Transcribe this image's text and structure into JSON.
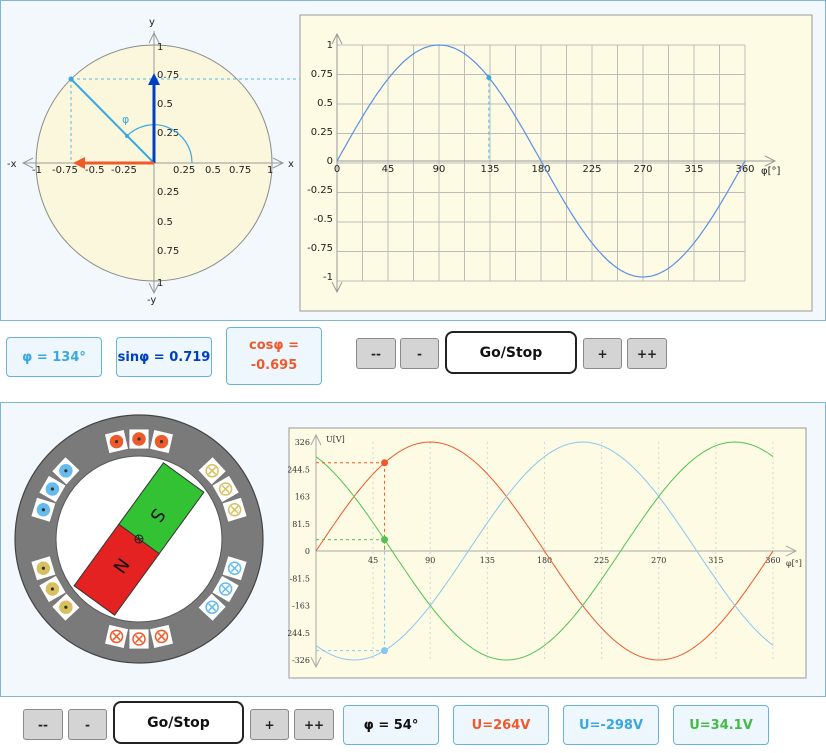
{
  "top": {
    "circle": {
      "axis_x": "x",
      "axis_neg_x": "-x",
      "axis_y": "y",
      "axis_neg_y": "-y",
      "angle_label": "φ",
      "x_ticks": [
        "-1",
        "-0.75",
        "-0.5",
        "-0.25",
        "0.25",
        "0.5",
        "0.75",
        "1"
      ],
      "y_ticks_pos": [
        "1",
        "0.75",
        "0.5",
        "0.25"
      ],
      "y_ticks_neg": [
        "0.25",
        "0.5",
        "0.75",
        "1"
      ]
    },
    "sine_chart": {
      "x_ticks": [
        "0",
        "45",
        "90",
        "135",
        "180",
        "225",
        "270",
        "315",
        "360"
      ],
      "y_ticks": [
        "1",
        "0.75",
        "0.5",
        "0.25",
        "0",
        "-0.25",
        "-0.5",
        "-0.75",
        "-1"
      ],
      "x_unit": "φ[°]"
    },
    "readouts": {
      "phi": "φ = 134°",
      "sin": "sinφ = 0.719",
      "cos": "cosφ = -0.695"
    },
    "controls": {
      "fast_back": "--",
      "back": "-",
      "go_stop": "Go/Stop",
      "forward": "+",
      "fast_forward": "++"
    }
  },
  "bottom": {
    "generator": {
      "north_label": "N",
      "south_label": "S"
    },
    "voltage_chart": {
      "y_unit": "U[V]",
      "x_unit": "φ[°]",
      "y_ticks": [
        "326",
        "244.5",
        "163",
        "81.5",
        "0",
        "-81.5",
        "-163",
        "-244.5",
        "-326"
      ],
      "x_ticks": [
        "45",
        "90",
        "135",
        "180",
        "225",
        "270",
        "315",
        "360"
      ]
    },
    "controls": {
      "fast_back": "--",
      "back": "-",
      "go_stop": "Go/Stop",
      "forward": "+",
      "fast_forward": "++"
    },
    "readouts": {
      "phi": "φ = 54°",
      "u1": "U=264V",
      "u2": "U=-298V",
      "u3": "U=34.1V"
    }
  },
  "chart_data": [
    {
      "type": "line",
      "title": "",
      "xlabel": "φ[°]",
      "ylabel": "",
      "xlim": [
        0,
        360
      ],
      "ylim": [
        -1,
        1
      ],
      "series": [
        {
          "function": "sin(φ)"
        }
      ],
      "marker": {
        "x": 134,
        "y": 0.719
      }
    },
    {
      "type": "line",
      "title": "",
      "xlabel": "φ[°]",
      "ylabel": "U[V]",
      "xlim": [
        0,
        360
      ],
      "ylim": [
        -326,
        326
      ],
      "series": [
        {
          "function": "326·sin(φ)",
          "color": "#ee5a2a"
        },
        {
          "function": "326·sin(φ-120°)",
          "color": "#88c8f0"
        },
        {
          "function": "326·sin(φ+120°)",
          "color": "#52c152"
        }
      ],
      "markers": [
        {
          "x": 54,
          "y": 264,
          "color": "#ee5a2a"
        },
        {
          "x": 54,
          "y": -298,
          "color": "#88c8f0"
        },
        {
          "x": 54,
          "y": 34.1,
          "color": "#52c152"
        }
      ]
    }
  ],
  "colors": {
    "orange": "#ee5a2a",
    "blue": "#0040c0",
    "light_blue": "#3aa8e0",
    "green": "#44bb44",
    "panel_bg": "#f2f8fc",
    "chart_bg": "#fdfbe4"
  }
}
